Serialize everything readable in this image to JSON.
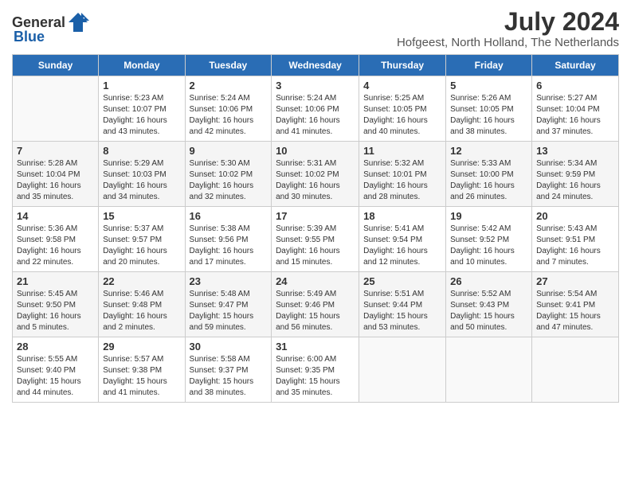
{
  "logo": {
    "text_general": "General",
    "text_blue": "Blue"
  },
  "title": "July 2024",
  "location": "Hofgeest, North Holland, The Netherlands",
  "columns": [
    "Sunday",
    "Monday",
    "Tuesday",
    "Wednesday",
    "Thursday",
    "Friday",
    "Saturday"
  ],
  "weeks": [
    [
      {
        "day": "",
        "info": ""
      },
      {
        "day": "1",
        "info": "Sunrise: 5:23 AM\nSunset: 10:07 PM\nDaylight: 16 hours\nand 43 minutes."
      },
      {
        "day": "2",
        "info": "Sunrise: 5:24 AM\nSunset: 10:06 PM\nDaylight: 16 hours\nand 42 minutes."
      },
      {
        "day": "3",
        "info": "Sunrise: 5:24 AM\nSunset: 10:06 PM\nDaylight: 16 hours\nand 41 minutes."
      },
      {
        "day": "4",
        "info": "Sunrise: 5:25 AM\nSunset: 10:05 PM\nDaylight: 16 hours\nand 40 minutes."
      },
      {
        "day": "5",
        "info": "Sunrise: 5:26 AM\nSunset: 10:05 PM\nDaylight: 16 hours\nand 38 minutes."
      },
      {
        "day": "6",
        "info": "Sunrise: 5:27 AM\nSunset: 10:04 PM\nDaylight: 16 hours\nand 37 minutes."
      }
    ],
    [
      {
        "day": "7",
        "info": "Sunrise: 5:28 AM\nSunset: 10:04 PM\nDaylight: 16 hours\nand 35 minutes."
      },
      {
        "day": "8",
        "info": "Sunrise: 5:29 AM\nSunset: 10:03 PM\nDaylight: 16 hours\nand 34 minutes."
      },
      {
        "day": "9",
        "info": "Sunrise: 5:30 AM\nSunset: 10:02 PM\nDaylight: 16 hours\nand 32 minutes."
      },
      {
        "day": "10",
        "info": "Sunrise: 5:31 AM\nSunset: 10:02 PM\nDaylight: 16 hours\nand 30 minutes."
      },
      {
        "day": "11",
        "info": "Sunrise: 5:32 AM\nSunset: 10:01 PM\nDaylight: 16 hours\nand 28 minutes."
      },
      {
        "day": "12",
        "info": "Sunrise: 5:33 AM\nSunset: 10:00 PM\nDaylight: 16 hours\nand 26 minutes."
      },
      {
        "day": "13",
        "info": "Sunrise: 5:34 AM\nSunset: 9:59 PM\nDaylight: 16 hours\nand 24 minutes."
      }
    ],
    [
      {
        "day": "14",
        "info": "Sunrise: 5:36 AM\nSunset: 9:58 PM\nDaylight: 16 hours\nand 22 minutes."
      },
      {
        "day": "15",
        "info": "Sunrise: 5:37 AM\nSunset: 9:57 PM\nDaylight: 16 hours\nand 20 minutes."
      },
      {
        "day": "16",
        "info": "Sunrise: 5:38 AM\nSunset: 9:56 PM\nDaylight: 16 hours\nand 17 minutes."
      },
      {
        "day": "17",
        "info": "Sunrise: 5:39 AM\nSunset: 9:55 PM\nDaylight: 16 hours\nand 15 minutes."
      },
      {
        "day": "18",
        "info": "Sunrise: 5:41 AM\nSunset: 9:54 PM\nDaylight: 16 hours\nand 12 minutes."
      },
      {
        "day": "19",
        "info": "Sunrise: 5:42 AM\nSunset: 9:52 PM\nDaylight: 16 hours\nand 10 minutes."
      },
      {
        "day": "20",
        "info": "Sunrise: 5:43 AM\nSunset: 9:51 PM\nDaylight: 16 hours\nand 7 minutes."
      }
    ],
    [
      {
        "day": "21",
        "info": "Sunrise: 5:45 AM\nSunset: 9:50 PM\nDaylight: 16 hours\nand 5 minutes."
      },
      {
        "day": "22",
        "info": "Sunrise: 5:46 AM\nSunset: 9:48 PM\nDaylight: 16 hours\nand 2 minutes."
      },
      {
        "day": "23",
        "info": "Sunrise: 5:48 AM\nSunset: 9:47 PM\nDaylight: 15 hours\nand 59 minutes."
      },
      {
        "day": "24",
        "info": "Sunrise: 5:49 AM\nSunset: 9:46 PM\nDaylight: 15 hours\nand 56 minutes."
      },
      {
        "day": "25",
        "info": "Sunrise: 5:51 AM\nSunset: 9:44 PM\nDaylight: 15 hours\nand 53 minutes."
      },
      {
        "day": "26",
        "info": "Sunrise: 5:52 AM\nSunset: 9:43 PM\nDaylight: 15 hours\nand 50 minutes."
      },
      {
        "day": "27",
        "info": "Sunrise: 5:54 AM\nSunset: 9:41 PM\nDaylight: 15 hours\nand 47 minutes."
      }
    ],
    [
      {
        "day": "28",
        "info": "Sunrise: 5:55 AM\nSunset: 9:40 PM\nDaylight: 15 hours\nand 44 minutes."
      },
      {
        "day": "29",
        "info": "Sunrise: 5:57 AM\nSunset: 9:38 PM\nDaylight: 15 hours\nand 41 minutes."
      },
      {
        "day": "30",
        "info": "Sunrise: 5:58 AM\nSunset: 9:37 PM\nDaylight: 15 hours\nand 38 minutes."
      },
      {
        "day": "31",
        "info": "Sunrise: 6:00 AM\nSunset: 9:35 PM\nDaylight: 15 hours\nand 35 minutes."
      },
      {
        "day": "",
        "info": ""
      },
      {
        "day": "",
        "info": ""
      },
      {
        "day": "",
        "info": ""
      }
    ]
  ]
}
